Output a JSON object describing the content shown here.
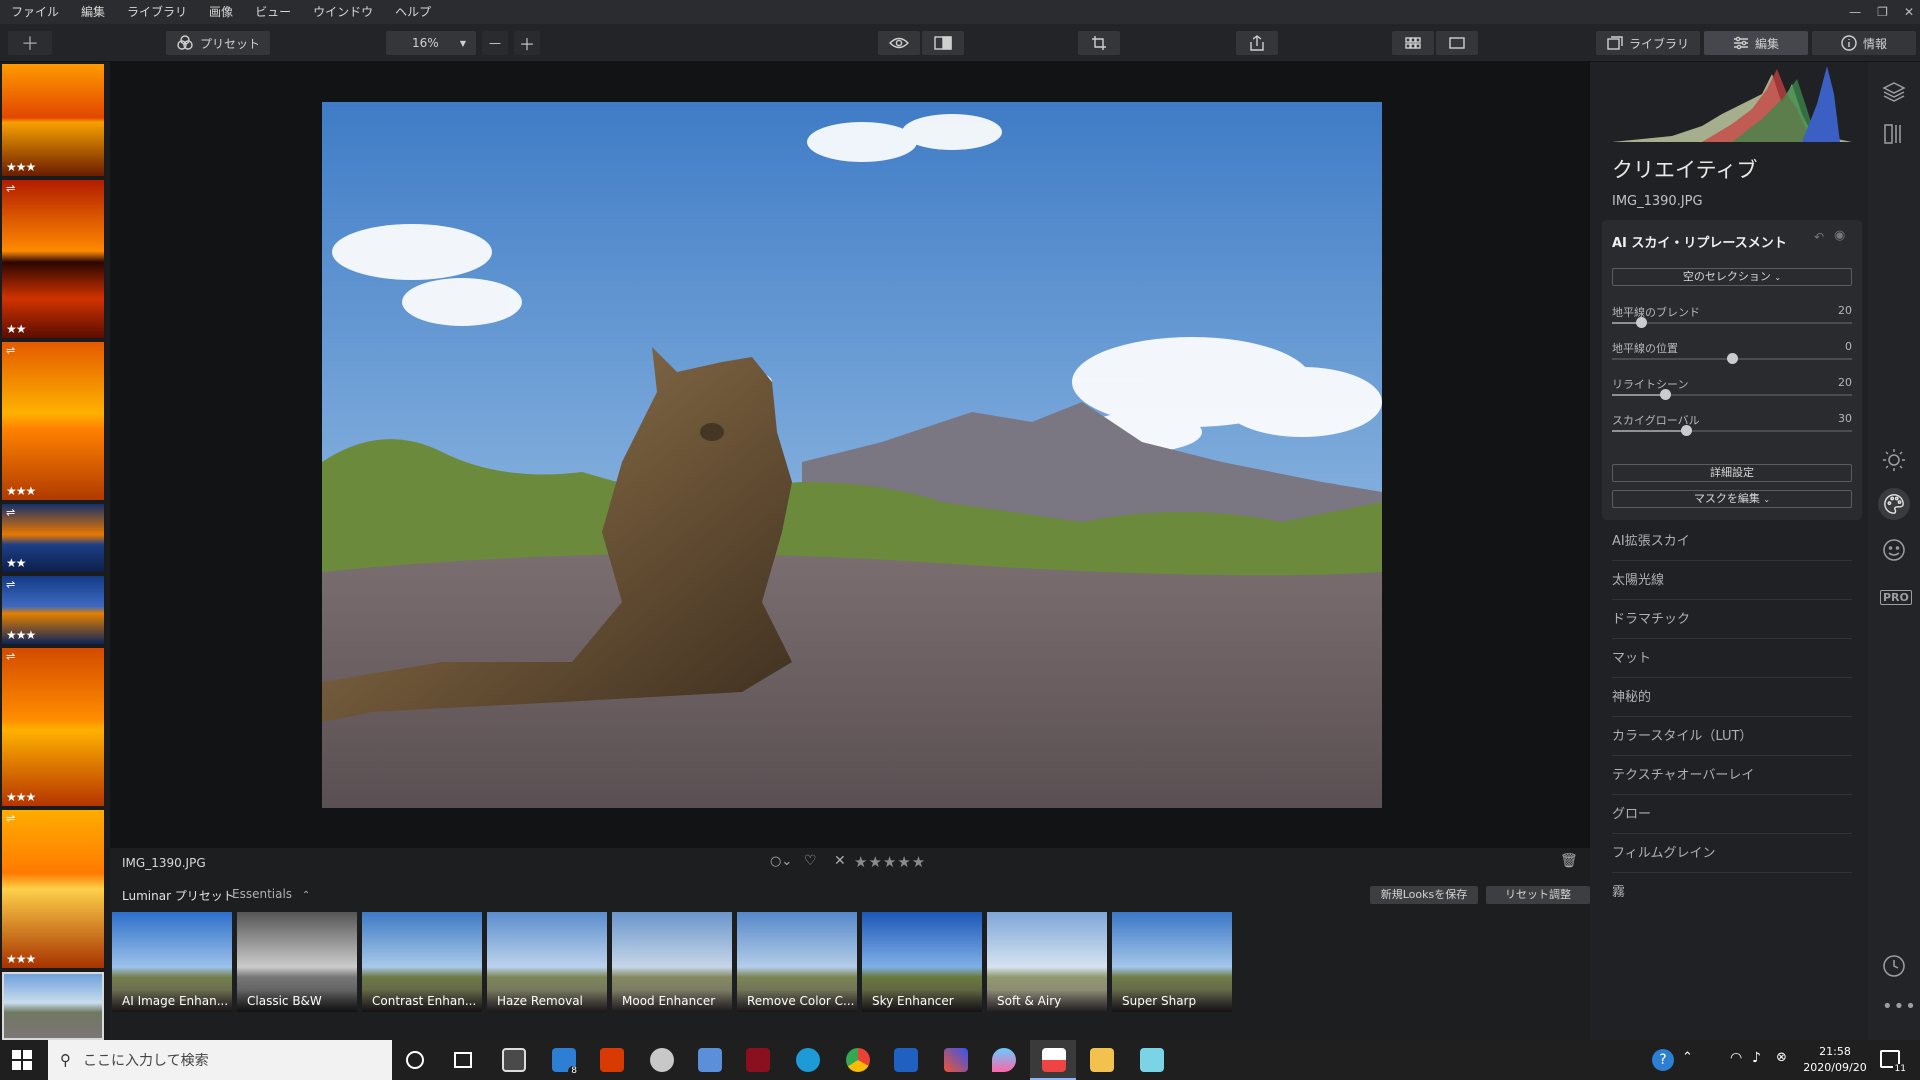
{
  "menubar": {
    "items": [
      "ファイル",
      "編集",
      "ライブラリ",
      "画像",
      "ビュー",
      "ウインドウ",
      "ヘルプ"
    ]
  },
  "toolbar": {
    "preset_label": "プリセット",
    "zoom": "16%",
    "library_tab": "ライブラリ",
    "edit_tab": "編集",
    "info_tab": "情報"
  },
  "filmstrip": {
    "ratings": [
      "★★★",
      "★★",
      "★★★",
      "★★",
      "★★★",
      "★★★",
      "★★★",
      ""
    ]
  },
  "image": {
    "filename_caption": "IMG_1390.JPG",
    "rating_stars": "★★★★★"
  },
  "presets_bar": {
    "category": "Luminar プリセット",
    "collection": "Essentials",
    "save_looks": "新規Looksを保存",
    "reset": "リセット調整"
  },
  "presets": [
    "AI Image Enhan...",
    "Classic B&W",
    "Contrast Enhan...",
    "Haze Removal",
    "Mood Enhancer",
    "Remove Color C...",
    "Sky Enhancer",
    "Soft & Airy",
    "Super Sharp"
  ],
  "panel": {
    "title": "クリエイティブ",
    "filename": "IMG_1390.JPG",
    "tool_title": "AI スカイ・リプレースメント",
    "sky_selection": "空のセレクション",
    "sliders": [
      {
        "label": "地平線のブレンド",
        "value": 20,
        "pct": 0.12
      },
      {
        "label": "地平線の位置",
        "value": 0,
        "pct": 0.5
      },
      {
        "label": "リライトシーン",
        "value": 20,
        "pct": 0.22
      },
      {
        "label": "スカイグローバル",
        "value": 30,
        "pct": 0.31
      }
    ],
    "advanced": "詳細設定",
    "edit_mask": "マスクを編集",
    "tools": [
      "AI拡張スカイ",
      "太陽光線",
      "ドラマチック",
      "マット",
      "神秘的",
      "カラースタイル（LUT）",
      "テクスチャオーバーレイ",
      "グロー",
      "フィルムグレイン",
      "霧"
    ]
  },
  "iconbar": {
    "pro": "PRO"
  },
  "taskbar": {
    "search_placeholder": "ここに入力して検索",
    "time": "21:58",
    "date": "2020/09/20",
    "mail_badge": "8",
    "notif_badge": "11"
  },
  "colors": {
    "accent": "#2d7fd3",
    "sky": "#4a86c9",
    "panel": "#202124"
  }
}
